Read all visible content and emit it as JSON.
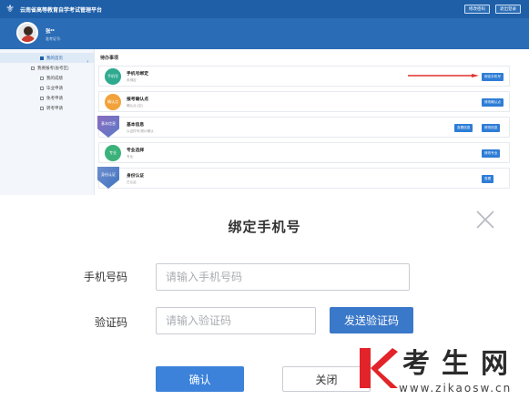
{
  "app": {
    "title": "云南省高等教育自学考试管理平台",
    "top_buttons": [
      "修改密码",
      "退出登录"
    ]
  },
  "user": {
    "name": "张**",
    "id_label": "准考证号:"
  },
  "sidebar": {
    "items": [
      {
        "label": "我的首页",
        "active": true
      },
      {
        "label": "我要报考(省考区)",
        "active": false
      },
      {
        "label": "我的成绩",
        "active": false
      },
      {
        "label": "毕业申请",
        "active": false
      },
      {
        "label": "免考申请",
        "active": false
      },
      {
        "label": "转考申请",
        "active": false
      }
    ]
  },
  "tasks": {
    "section_title": "待办事项",
    "rows": [
      {
        "circle": "手机号",
        "name": "手机号绑定",
        "desc": "未绑定",
        "buttons": [
          "绑定手机号"
        ],
        "color": "#2eaa8f",
        "style": "circle"
      },
      {
        "circle": "确认点",
        "name": "报考确认点",
        "desc": "确认点:(空)",
        "buttons": [
          "修改确认点"
        ],
        "color": "#f2a23a",
        "style": "circle"
      },
      {
        "circle": "基本信息",
        "name": "基本信息",
        "desc": "以证件号,照片确认",
        "buttons": [
          "查看信息",
          "修改信息"
        ],
        "color": "#8a6bbf",
        "style": "ribbon"
      },
      {
        "circle": "专业",
        "name": "专业选择",
        "desc": "专业:",
        "buttons": [
          "修改专业"
        ],
        "color": "#3bb27a",
        "style": "circle"
      },
      {
        "circle": "身份认证",
        "name": "身份认证",
        "desc": "已认证",
        "buttons": [
          "查看"
        ],
        "color": "#6f8fcf",
        "style": "ribbon"
      }
    ]
  },
  "modal": {
    "title": "绑定手机号",
    "phone_label": "手机号码",
    "phone_placeholder": "请输入手机号码",
    "code_label": "验证码",
    "code_placeholder": "请输入验证码",
    "send_code_label": "发送验证码",
    "confirm_label": "确认",
    "close_label": "关闭"
  },
  "watermark": {
    "text": "考生网",
    "url": "www.zikaosw.cn"
  },
  "colors": {
    "primary": "#1e5fa8",
    "button_blue": "#3c82db",
    "arrow_red": "#e0322a"
  }
}
